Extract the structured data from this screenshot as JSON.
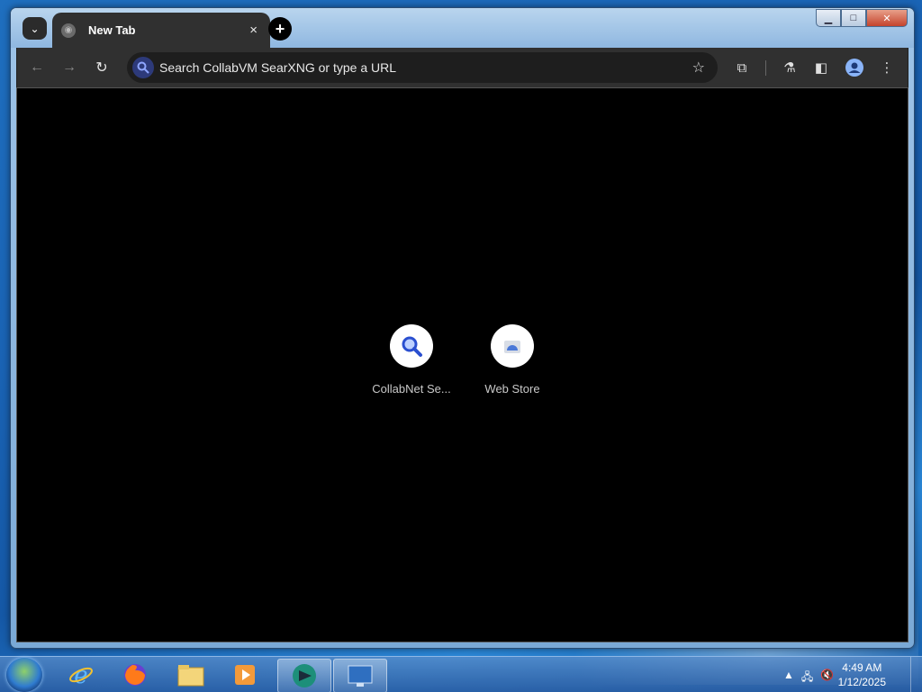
{
  "browser": {
    "tab": {
      "title": "New Tab",
      "close": "×"
    },
    "tabsearch_glyph": "⌄",
    "newtab_glyph": "+",
    "omnibox": {
      "placeholder": "Search CollabVM SearXNG or type a URL"
    },
    "shortcuts": [
      {
        "label": "CollabNet Se...",
        "icon": "search-icon"
      },
      {
        "label": "Web Store",
        "icon": "web-store-icon"
      }
    ],
    "window_buttons": {
      "minimize": "▁",
      "maximize": "□",
      "close": "✕"
    }
  },
  "taskbar": {
    "apps": [
      "internet-explorer",
      "firefox",
      "file-explorer",
      "media-player",
      "browser-active",
      "remote-desktop"
    ],
    "clock": {
      "time": "4:49 AM",
      "date": "1/12/2025"
    }
  },
  "colors": {
    "accent": "#3f63d6",
    "content_bg": "#000000",
    "toolbar": "#303030"
  }
}
